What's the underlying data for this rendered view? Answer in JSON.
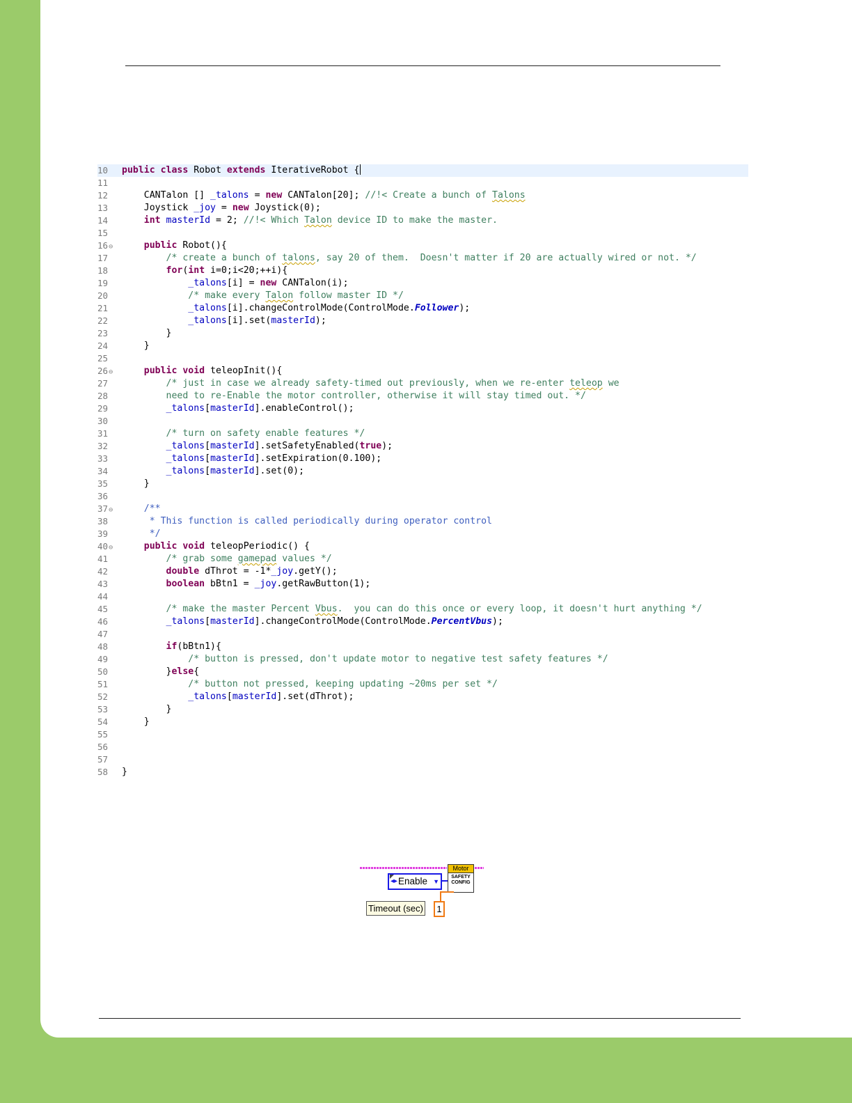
{
  "colors": {
    "page_background": "#9bcb6a",
    "keyword": "#7f0055",
    "comment": "#3f7f5f",
    "javadoc": "#3f5fbf",
    "field": "#0000c0",
    "enum_wire": "#1a1ae6",
    "numeric_wire": "#f07a14",
    "cluster_wire": "#e040e0",
    "vi_header": "#f2c200"
  },
  "code": {
    "lines": [
      {
        "num": "10",
        "fold": false,
        "highlight": true,
        "caret": true,
        "tokens": [
          [
            "kw",
            "public"
          ],
          [
            "t",
            " "
          ],
          [
            "kw",
            "class"
          ],
          [
            "t",
            " Robot "
          ],
          [
            "kw",
            "extends"
          ],
          [
            "t",
            " IterativeRobot {"
          ]
        ]
      },
      {
        "num": "11",
        "fold": false,
        "tokens": []
      },
      {
        "num": "12",
        "fold": false,
        "tokens": [
          [
            "t",
            "    CANTalon [] "
          ],
          [
            "fd",
            "_talons"
          ],
          [
            "t",
            " = "
          ],
          [
            "kw",
            "new"
          ],
          [
            "t",
            " CANTalon[20]; "
          ],
          [
            "cm",
            "//!< Create a bunch of "
          ],
          [
            "cmsq",
            "Talons"
          ]
        ]
      },
      {
        "num": "13",
        "fold": false,
        "tokens": [
          [
            "t",
            "    Joystick "
          ],
          [
            "fd",
            "_joy"
          ],
          [
            "t",
            " = "
          ],
          [
            "kw",
            "new"
          ],
          [
            "t",
            " Joystick(0);"
          ]
        ]
      },
      {
        "num": "14",
        "fold": false,
        "tokens": [
          [
            "t",
            "    "
          ],
          [
            "kw",
            "int"
          ],
          [
            "t",
            " "
          ],
          [
            "fd",
            "masterId"
          ],
          [
            "t",
            " = 2; "
          ],
          [
            "cm",
            "//!< Which "
          ],
          [
            "cmsq",
            "Talon"
          ],
          [
            "cm",
            " device ID to make the master."
          ]
        ]
      },
      {
        "num": "15",
        "fold": false,
        "tokens": []
      },
      {
        "num": "16",
        "fold": true,
        "tokens": [
          [
            "t",
            "    "
          ],
          [
            "kw",
            "public"
          ],
          [
            "t",
            " Robot(){"
          ]
        ]
      },
      {
        "num": "17",
        "fold": false,
        "tokens": [
          [
            "cm",
            "        /* create a bunch of "
          ],
          [
            "cmsq",
            "talons"
          ],
          [
            "cm",
            ", say 20 of them.  Doesn't matter if 20 are actually wired or not. */"
          ]
        ]
      },
      {
        "num": "18",
        "fold": false,
        "tokens": [
          [
            "t",
            "        "
          ],
          [
            "kw",
            "for"
          ],
          [
            "t",
            "("
          ],
          [
            "kw",
            "int"
          ],
          [
            "t",
            " i=0;i<20;++i){"
          ]
        ]
      },
      {
        "num": "19",
        "fold": false,
        "tokens": [
          [
            "t",
            "            "
          ],
          [
            "fd",
            "_talons"
          ],
          [
            "t",
            "[i] = "
          ],
          [
            "kw",
            "new"
          ],
          [
            "t",
            " CANTalon(i);"
          ]
        ]
      },
      {
        "num": "20",
        "fold": false,
        "tokens": [
          [
            "cm",
            "            /* make every "
          ],
          [
            "cmsq",
            "Talon"
          ],
          [
            "cm",
            " follow master ID */"
          ]
        ]
      },
      {
        "num": "21",
        "fold": false,
        "tokens": [
          [
            "t",
            "            "
          ],
          [
            "fd",
            "_talons"
          ],
          [
            "t",
            "[i].changeControlMode(ControlMode."
          ],
          [
            "it",
            "Follower"
          ],
          [
            "t",
            ");"
          ]
        ]
      },
      {
        "num": "22",
        "fold": false,
        "tokens": [
          [
            "t",
            "            "
          ],
          [
            "fd",
            "_talons"
          ],
          [
            "t",
            "[i].set("
          ],
          [
            "fd",
            "masterId"
          ],
          [
            "t",
            ");"
          ]
        ]
      },
      {
        "num": "23",
        "fold": false,
        "tokens": [
          [
            "t",
            "        }"
          ]
        ]
      },
      {
        "num": "24",
        "fold": false,
        "tokens": [
          [
            "t",
            "    }"
          ]
        ]
      },
      {
        "num": "25",
        "fold": false,
        "tokens": []
      },
      {
        "num": "26",
        "fold": true,
        "tokens": [
          [
            "t",
            "    "
          ],
          [
            "kw",
            "public"
          ],
          [
            "t",
            " "
          ],
          [
            "kw",
            "void"
          ],
          [
            "t",
            " teleopInit(){"
          ]
        ]
      },
      {
        "num": "27",
        "fold": false,
        "tokens": [
          [
            "cm",
            "        /* just in case we already safety-timed out previously, when we re-enter "
          ],
          [
            "cmsq",
            "teleop"
          ],
          [
            "cm",
            " we"
          ]
        ]
      },
      {
        "num": "28",
        "fold": false,
        "tokens": [
          [
            "cm",
            "        need to re-Enable the motor controller, otherwise it will stay timed out. */"
          ]
        ]
      },
      {
        "num": "29",
        "fold": false,
        "tokens": [
          [
            "t",
            "        "
          ],
          [
            "fd",
            "_talons"
          ],
          [
            "t",
            "["
          ],
          [
            "fd",
            "masterId"
          ],
          [
            "t",
            "].enableControl();"
          ]
        ]
      },
      {
        "num": "30",
        "fold": false,
        "tokens": []
      },
      {
        "num": "31",
        "fold": false,
        "tokens": [
          [
            "cm",
            "        /* turn on safety enable features */"
          ]
        ]
      },
      {
        "num": "32",
        "fold": false,
        "tokens": [
          [
            "t",
            "        "
          ],
          [
            "fd",
            "_talons"
          ],
          [
            "t",
            "["
          ],
          [
            "fd",
            "masterId"
          ],
          [
            "t",
            "].setSafetyEnabled("
          ],
          [
            "kw",
            "true"
          ],
          [
            "t",
            ");"
          ]
        ]
      },
      {
        "num": "33",
        "fold": false,
        "tokens": [
          [
            "t",
            "        "
          ],
          [
            "fd",
            "_talons"
          ],
          [
            "t",
            "["
          ],
          [
            "fd",
            "masterId"
          ],
          [
            "t",
            "].setExpiration(0.100);"
          ]
        ]
      },
      {
        "num": "34",
        "fold": false,
        "tokens": [
          [
            "t",
            "        "
          ],
          [
            "fd",
            "_talons"
          ],
          [
            "t",
            "["
          ],
          [
            "fd",
            "masterId"
          ],
          [
            "t",
            "].set(0);"
          ]
        ]
      },
      {
        "num": "35",
        "fold": false,
        "tokens": [
          [
            "t",
            "    }"
          ]
        ]
      },
      {
        "num": "36",
        "fold": false,
        "tokens": []
      },
      {
        "num": "37",
        "fold": true,
        "tokens": [
          [
            "jd",
            "    /**"
          ]
        ]
      },
      {
        "num": "38",
        "fold": false,
        "tokens": [
          [
            "jd",
            "     * This function is called periodically during operator control"
          ]
        ]
      },
      {
        "num": "39",
        "fold": false,
        "tokens": [
          [
            "jd",
            "     */"
          ]
        ]
      },
      {
        "num": "40",
        "fold": true,
        "tokens": [
          [
            "t",
            "    "
          ],
          [
            "kw",
            "public"
          ],
          [
            "t",
            " "
          ],
          [
            "kw",
            "void"
          ],
          [
            "t",
            " teleopPeriodic() {"
          ]
        ]
      },
      {
        "num": "41",
        "fold": false,
        "tokens": [
          [
            "cm",
            "        /* grab some "
          ],
          [
            "cmsq",
            "gamepad"
          ],
          [
            "cm",
            " values */"
          ]
        ]
      },
      {
        "num": "42",
        "fold": false,
        "tokens": [
          [
            "t",
            "        "
          ],
          [
            "kw",
            "double"
          ],
          [
            "t",
            " dThrot = -1*"
          ],
          [
            "fd",
            "_joy"
          ],
          [
            "t",
            ".getY();"
          ]
        ]
      },
      {
        "num": "43",
        "fold": false,
        "tokens": [
          [
            "t",
            "        "
          ],
          [
            "kw",
            "boolean"
          ],
          [
            "t",
            " bBtn1 = "
          ],
          [
            "fd",
            "_joy"
          ],
          [
            "t",
            ".getRawButton(1);"
          ]
        ]
      },
      {
        "num": "44",
        "fold": false,
        "tokens": []
      },
      {
        "num": "45",
        "fold": false,
        "tokens": [
          [
            "cm",
            "        /* make the master Percent "
          ],
          [
            "cmsq",
            "Vbus"
          ],
          [
            "cm",
            ".  you can do this once or every loop, it doesn't hurt anything */"
          ]
        ]
      },
      {
        "num": "46",
        "fold": false,
        "tokens": [
          [
            "t",
            "        "
          ],
          [
            "fd",
            "_talons"
          ],
          [
            "t",
            "["
          ],
          [
            "fd",
            "masterId"
          ],
          [
            "t",
            "].changeControlMode(ControlMode."
          ],
          [
            "it",
            "PercentVbus"
          ],
          [
            "t",
            ");"
          ]
        ]
      },
      {
        "num": "47",
        "fold": false,
        "tokens": []
      },
      {
        "num": "48",
        "fold": false,
        "tokens": [
          [
            "t",
            "        "
          ],
          [
            "kw",
            "if"
          ],
          [
            "t",
            "(bBtn1){"
          ]
        ]
      },
      {
        "num": "49",
        "fold": false,
        "tokens": [
          [
            "cm",
            "            /* button is pressed, don't update motor to negative test safety features */"
          ]
        ]
      },
      {
        "num": "50",
        "fold": false,
        "tokens": [
          [
            "t",
            "        }"
          ],
          [
            "kw",
            "else"
          ],
          [
            "t",
            "{"
          ]
        ]
      },
      {
        "num": "51",
        "fold": false,
        "tokens": [
          [
            "cm",
            "            /* button not pressed, keeping updating ~20ms per set */"
          ]
        ]
      },
      {
        "num": "52",
        "fold": false,
        "tokens": [
          [
            "t",
            "            "
          ],
          [
            "fd",
            "_talons"
          ],
          [
            "t",
            "["
          ],
          [
            "fd",
            "masterId"
          ],
          [
            "t",
            "].set(dThrot);"
          ]
        ]
      },
      {
        "num": "53",
        "fold": false,
        "tokens": [
          [
            "t",
            "        }"
          ]
        ]
      },
      {
        "num": "54",
        "fold": false,
        "tokens": [
          [
            "t",
            "    }"
          ]
        ]
      },
      {
        "num": "55",
        "fold": false,
        "tokens": []
      },
      {
        "num": "56",
        "fold": false,
        "tokens": []
      },
      {
        "num": "57",
        "fold": false,
        "tokens": []
      },
      {
        "num": "58",
        "fold": false,
        "tokens": [
          [
            "t",
            "}"
          ]
        ]
      }
    ]
  },
  "labview": {
    "enum_value": "Enable",
    "vi_header": "Motor",
    "vi_body_line1": "SAFETY",
    "vi_body_line2": "CONFIG",
    "timeout_label": "Timeout (sec)",
    "timeout_value": "1"
  }
}
